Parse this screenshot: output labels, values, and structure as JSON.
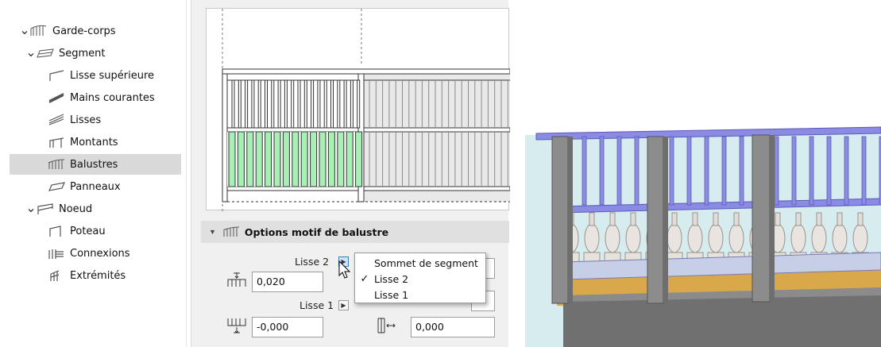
{
  "tree": {
    "items": [
      {
        "label": "Garde-corps",
        "level": 0,
        "expandable": true,
        "icon": "railing-icon"
      },
      {
        "label": "Segment",
        "level": 1,
        "expandable": true,
        "icon": "segment-icon"
      },
      {
        "label": "Lisse supérieure",
        "level": 2,
        "expandable": false,
        "icon": "top-rail-icon"
      },
      {
        "label": "Mains courantes",
        "level": 2,
        "expandable": false,
        "icon": "handrail-icon"
      },
      {
        "label": "Lisses",
        "level": 2,
        "expandable": false,
        "icon": "rails-icon"
      },
      {
        "label": "Montants",
        "level": 2,
        "expandable": false,
        "icon": "posts-icon"
      },
      {
        "label": "Balustres",
        "level": 2,
        "expandable": false,
        "icon": "balusters-icon",
        "selected": true
      },
      {
        "label": "Panneaux",
        "level": 2,
        "expandable": false,
        "icon": "panels-icon"
      },
      {
        "label": "Noeud",
        "level": 1,
        "expandable": true,
        "icon": "node-icon"
      },
      {
        "label": "Poteau",
        "level": 2,
        "expandable": false,
        "icon": "pole-icon"
      },
      {
        "label": "Connexions",
        "level": 2,
        "expandable": false,
        "icon": "connections-icon"
      },
      {
        "label": "Extrémités",
        "level": 2,
        "expandable": false,
        "icon": "ends-icon"
      }
    ]
  },
  "options": {
    "title": "Options motif de balustre",
    "lisse2_label": "Lisse 2",
    "lisse2_value": "0,020",
    "lisse1_label": "Lisse 1",
    "lisse1_value": "-0,000",
    "offset_value": "0,000"
  },
  "popup": {
    "items": [
      {
        "label": "Sommet de segment",
        "checked": false
      },
      {
        "label": "Lisse 2",
        "checked": true
      },
      {
        "label": "Lisse 1",
        "checked": false
      }
    ]
  },
  "colors": {
    "selection": "#d9d9d9",
    "baluster_highlight": "#a8efb6",
    "rail_blue": "#8c8ce6",
    "floor": "#d9a84a"
  }
}
